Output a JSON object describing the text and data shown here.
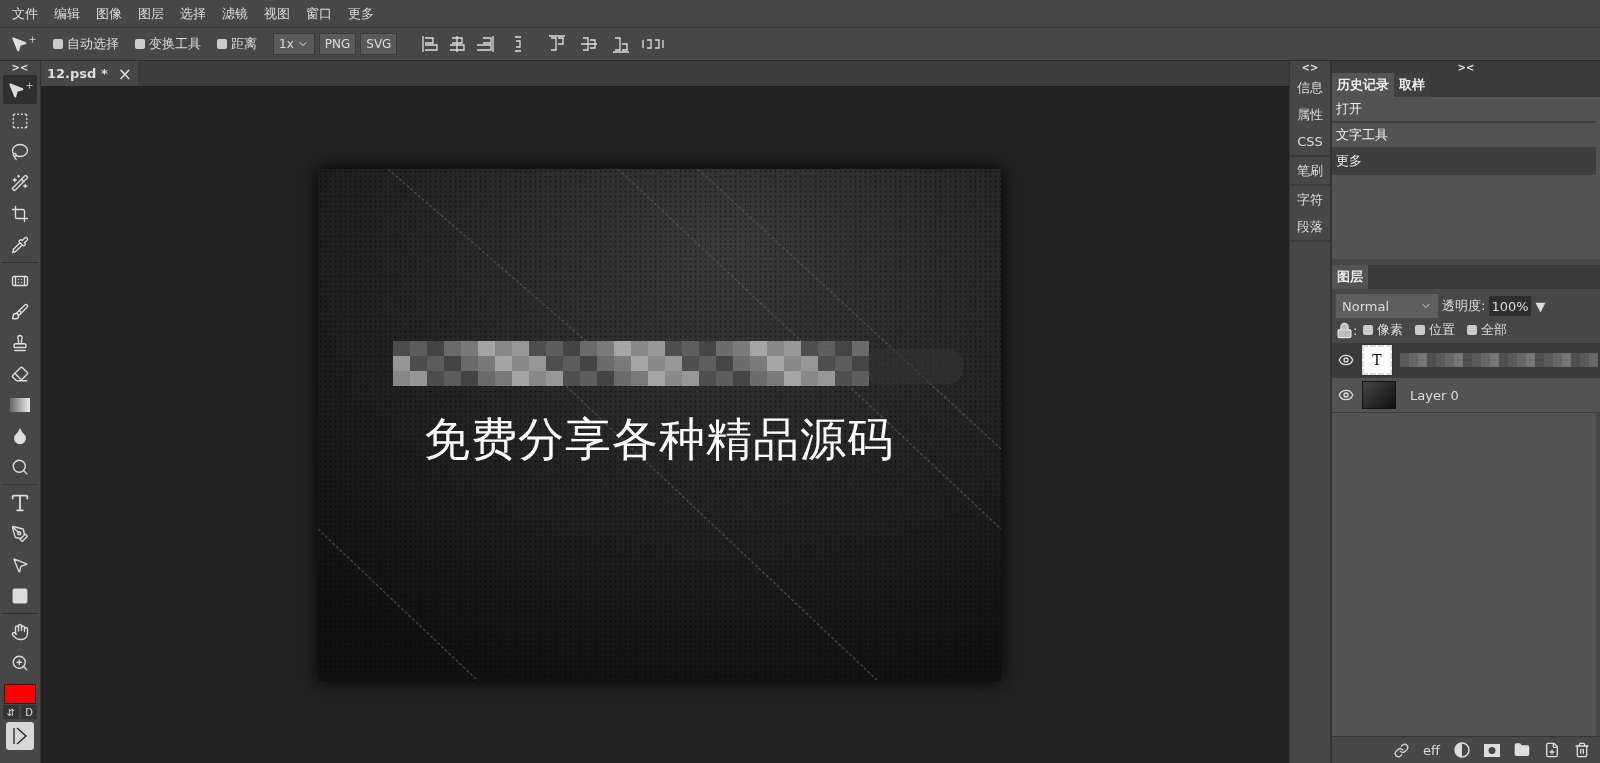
{
  "menu": [
    "文件",
    "编辑",
    "图像",
    "图层",
    "选择",
    "滤镜",
    "视图",
    "窗口",
    "更多"
  ],
  "toolbar": {
    "checkboxes": [
      {
        "label": "自动选择",
        "checked": false
      },
      {
        "label": "变换工具",
        "checked": false
      },
      {
        "label": "距离",
        "checked": false
      }
    ],
    "scale": "1x",
    "export_buttons": [
      "PNG",
      "SVG"
    ]
  },
  "left_toggle": "><",
  "document_tabs": [
    {
      "label": "12.psd *",
      "close": "×",
      "selected": true
    }
  ],
  "tools": [
    {
      "kind": "move",
      "selected": true
    },
    {
      "kind": "marquee",
      "selected": false
    },
    {
      "kind": "lasso",
      "selected": false
    },
    {
      "kind": "quick-select",
      "selected": false
    },
    {
      "kind": "crop",
      "selected": false
    },
    {
      "kind": "eyedropper",
      "selected": false
    },
    {
      "kind": "healing",
      "selected": false
    },
    {
      "kind": "brush",
      "selected": false
    },
    {
      "kind": "stamp",
      "selected": false
    },
    {
      "kind": "eraser",
      "selected": false
    },
    {
      "kind": "gradient",
      "selected": false
    },
    {
      "kind": "blur",
      "selected": false
    },
    {
      "kind": "dodge",
      "selected": false
    },
    {
      "kind": "type",
      "selected": false
    },
    {
      "kind": "pen",
      "selected": false
    },
    {
      "kind": "path-select",
      "selected": false
    },
    {
      "kind": "shape",
      "selected": false
    },
    {
      "kind": "hand",
      "selected": false
    },
    {
      "kind": "zoom",
      "selected": false
    }
  ],
  "foreground": {
    "color": "#ff0000"
  },
  "swap": "⇵",
  "default": "D",
  "canvas": {
    "kind": "picture",
    "text": "免费分享各种精品源码"
  },
  "side_tabs": {
    "toggle": "<>",
    "items": [
      "信息",
      "属性",
      "CSS",
      "笔刷",
      "字符",
      "段落"
    ]
  },
  "history": {
    "toggle": "><",
    "tabs": [
      {
        "label": "历史记录",
        "selected": true
      },
      {
        "label": "取样",
        "selected": false
      }
    ],
    "items": [
      {
        "label": "打开",
        "selected": false
      },
      {
        "label": "文字工具",
        "selected": false
      },
      {
        "label": "更多",
        "selected": true
      }
    ]
  },
  "layers": {
    "tab": "图层",
    "blend_mode": "Normal",
    "opacity_label": "透明度:",
    "opacity": "100%",
    "opacity_menu": "▼",
    "lock_colon": ":",
    "locks": [
      {
        "label": "像素",
        "checked": false
      },
      {
        "label": "位置",
        "checked": false
      },
      {
        "label": "全部",
        "checked": false
      }
    ],
    "items": [
      {
        "kind": "text",
        "thumb": "T",
        "visible": true,
        "selected": true
      },
      {
        "name": "Layer 0",
        "visible": true,
        "selected": false
      }
    ],
    "footer_text": "eff"
  }
}
